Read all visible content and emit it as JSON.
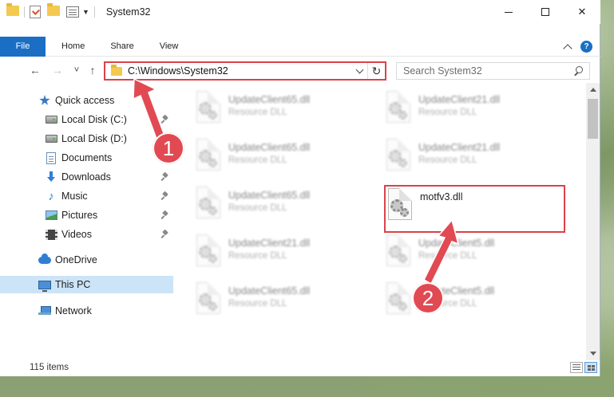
{
  "window": {
    "title": "System32",
    "controls": {
      "minimize": "",
      "maximize": "",
      "close": "✕"
    }
  },
  "ribbon": {
    "tabs": [
      {
        "label": "File"
      },
      {
        "label": "Home"
      },
      {
        "label": "Share"
      },
      {
        "label": "View"
      }
    ],
    "help": "?"
  },
  "navigation": {
    "back": "←",
    "forward": "→",
    "recent": "˅",
    "up": "↑",
    "address": "C:\\Windows\\System32",
    "refresh": "↻",
    "search_placeholder": "Search System32"
  },
  "sidebar": {
    "items": [
      {
        "label": "Quick access",
        "icon": "star-icon",
        "pinned": false
      },
      {
        "label": "Local Disk (C:)",
        "icon": "drive-icon",
        "pinned": true
      },
      {
        "label": "Local Disk (D:)",
        "icon": "drive-icon",
        "pinned": false
      },
      {
        "label": "Documents",
        "icon": "documents-icon",
        "pinned": true
      },
      {
        "label": "Downloads",
        "icon": "downloads-icon",
        "pinned": true
      },
      {
        "label": "Music",
        "icon": "music-icon",
        "pinned": true
      },
      {
        "label": "Pictures",
        "icon": "pictures-icon",
        "pinned": true
      },
      {
        "label": "Videos",
        "icon": "videos-icon",
        "pinned": true
      },
      {
        "label": "OneDrive",
        "icon": "onedrive-icon",
        "pinned": false
      },
      {
        "label": "This PC",
        "icon": "this-pc-icon",
        "pinned": false,
        "selected": true
      },
      {
        "label": "Network",
        "icon": "network-icon",
        "pinned": false
      }
    ]
  },
  "files": [
    {
      "name": "UpdateClient65.dll",
      "type": "Resource DLL",
      "blurred": true
    },
    {
      "name": "UpdateClient21.dll",
      "type": "Resource DLL",
      "blurred": true
    },
    {
      "name": "UpdateClient65.dll",
      "type": "Resource DLL",
      "blurred": true
    },
    {
      "name": "UpdateClient21.dll",
      "type": "Resource DLL",
      "blurred": true
    },
    {
      "name": "UpdateClient65.dll",
      "type": "Resource DLL",
      "blurred": true
    },
    {
      "name": "motfv3.dll",
      "type": "",
      "blurred": false
    },
    {
      "name": "UpdateClient21.dll",
      "type": "Resource DLL",
      "blurred": true
    },
    {
      "name": "UpdateClient5.dll",
      "type": "Resource DLL",
      "blurred": true
    },
    {
      "name": "UpdateClient65.dll",
      "type": "Resource DLL",
      "blurred": true
    },
    {
      "name": "UpdateClient5.dll",
      "type": "Resource DLL",
      "blurred": true
    }
  ],
  "status": {
    "item_count": "115 items"
  },
  "annotations": [
    {
      "label": "1"
    },
    {
      "label": "2"
    }
  ],
  "colors": {
    "accent": "#1a6fc4",
    "highlight": "#d9434a",
    "selected_bg": "#cce4f7"
  }
}
